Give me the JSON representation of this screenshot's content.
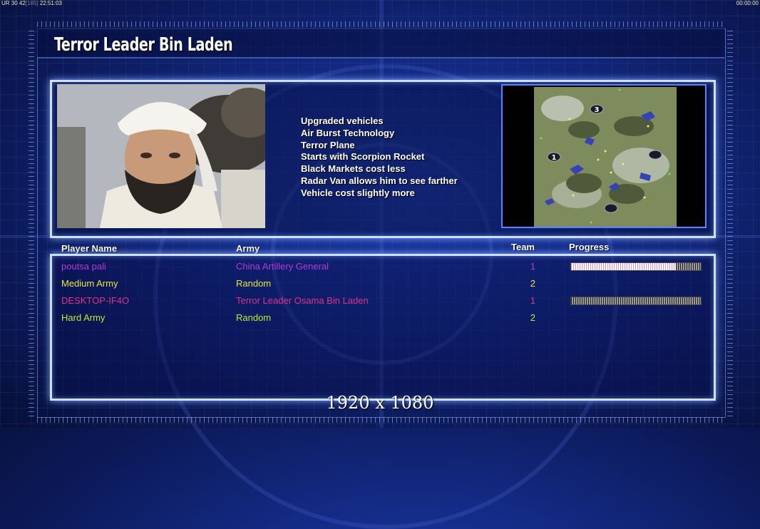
{
  "hud": {
    "stats": "UR 30 42",
    "frames": "165",
    "clock": "22:51:03",
    "timer": "00:00:00"
  },
  "general": {
    "title": "Terror Leader Bin Laden",
    "features": [
      "Upgraded vehicles",
      "Air Burst Technology",
      "Terror Plane",
      "Starts with Scorpion Rocket",
      "Black Markets cost less",
      "Radar Van allows him to see farther",
      "Vehicle cost slightly more"
    ]
  },
  "map": {
    "start_positions": [
      "1",
      "3"
    ]
  },
  "table": {
    "headers": {
      "player": "Player Name",
      "army": "Army",
      "team": "Team",
      "progress": "Progress"
    },
    "rows": [
      {
        "name": "poutsa pali",
        "army": "China Artillery General",
        "team": "1",
        "color": "#b23ad4",
        "progress": 0.81
      },
      {
        "name": "Medium Army",
        "army": "Random",
        "team": "2",
        "color": "#e8e43c",
        "progress": null
      },
      {
        "name": "DESKTOP-IF4O",
        "army": "Terror Leader Osama Bin Laden",
        "team": "1",
        "color": "#e0328a",
        "progress": 0.0
      },
      {
        "name": "Hard Army",
        "army": "Random",
        "team": "2",
        "color": "#b8ee38",
        "progress": null
      }
    ]
  },
  "resolution_label": "1920 x 1080"
}
